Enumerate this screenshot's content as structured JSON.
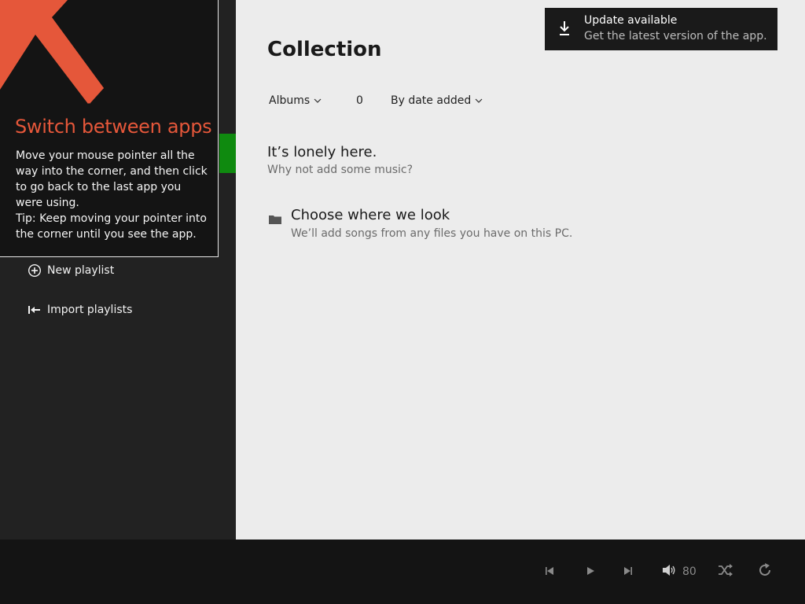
{
  "tip": {
    "title": "Switch between apps",
    "body": "Move your mouse pointer all the way into the corner, and then click to go back to the last app you were using.",
    "tip_text": "Tip: Keep moving your pointer into the corner until you see the app.",
    "arrow_icon": "corner-arrow-icon",
    "arrow_color": "#e5573a"
  },
  "sidebar": {
    "accent_color": "#0f8a0f",
    "items": [
      {
        "label": "New playlist",
        "icon": "plus-circle-icon"
      },
      {
        "label": "Import playlists",
        "icon": "import-icon"
      }
    ]
  },
  "main": {
    "title": "Collection",
    "filters": {
      "view_label": "Albums",
      "count": "0",
      "sort_label": "By date added"
    },
    "empty_state": {
      "title": "It’s lonely here.",
      "subtitle": "Why not add some music?"
    },
    "choose": {
      "title": "Choose where we look",
      "subtitle": "We’ll add songs from any files you have on this PC.",
      "icon": "folder-icon"
    }
  },
  "toast": {
    "title": "Update available",
    "subtitle": "Get the latest version of the app.",
    "icon": "download-icon"
  },
  "player": {
    "volume": "80",
    "buttons": [
      "previous-icon",
      "play-icon",
      "next-icon",
      "volume-icon",
      "shuffle-icon",
      "repeat-icon"
    ]
  }
}
